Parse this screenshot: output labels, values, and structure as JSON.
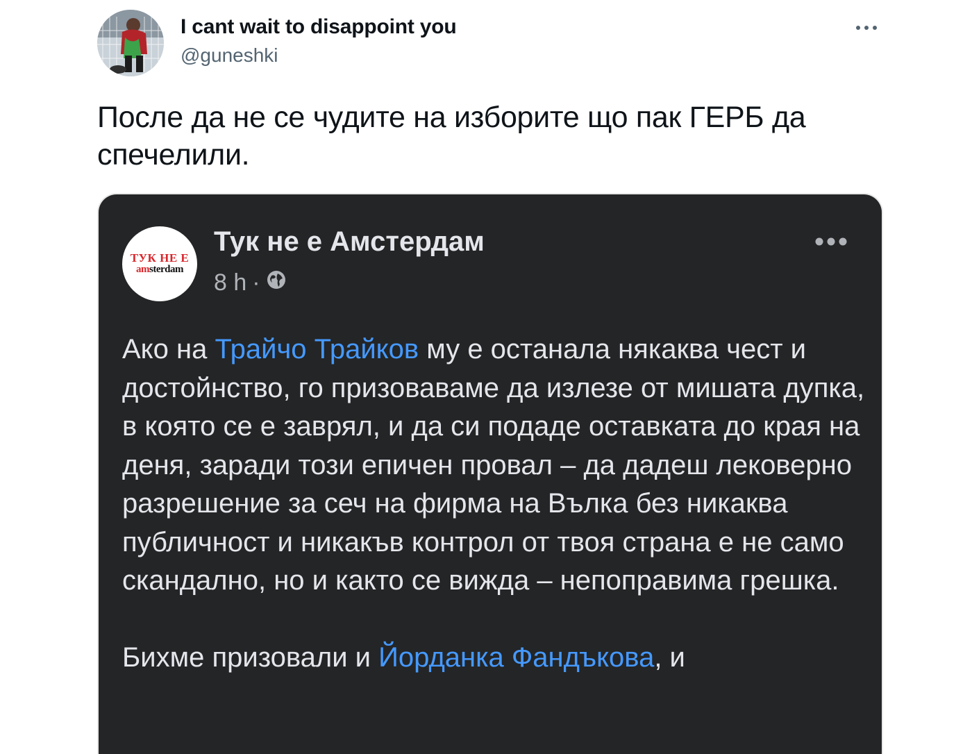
{
  "tweet": {
    "display_name": "I cant wait to disappoint you",
    "handle": "@guneshki",
    "text": "После да не се чудите на изборите що пак ГЕРБ да спечелили."
  },
  "embedded_post": {
    "logo_line1": "ТУК НЕ Е",
    "logo_line2_red": "am",
    "logo_line2": "sterdam",
    "page_name": "Тук не е Амстердам",
    "time": "8 h",
    "separator": "·",
    "paragraph1": {
      "before": "Ако на ",
      "mention": "Трайчо Трайков",
      "after": " му е останала някаква чест и достойнство, го призоваваме да излезе от мишата дупка, в която се е заврял, и да си подаде оставката до края на деня, заради този епичен провал – да дадеш лековерно разрешение за сеч на фирма на Вълка без никаква публичност и никакъв контрол от твоя страна е не само скандално, но и както се вижда – непоправима грешка."
    },
    "paragraph2": {
      "before": "Бихме призовали и ",
      "mention": "Йорданка Фандъкова",
      "after": ", и"
    },
    "icons": [
      "globe-icon",
      "more-icon"
    ]
  },
  "colors": {
    "mention": "#4599ff",
    "card_bg": "#242526",
    "handle": "#536471"
  }
}
